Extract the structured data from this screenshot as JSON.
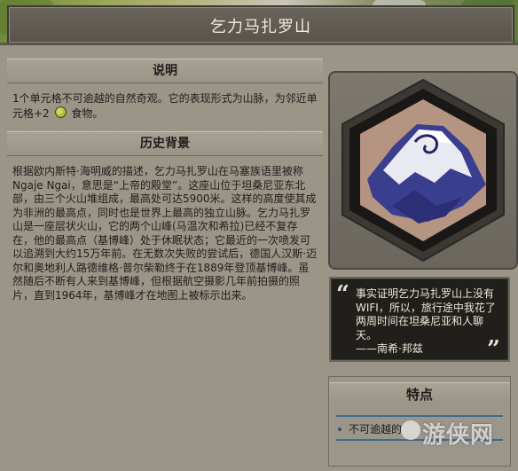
{
  "header": {
    "title": "乞力马扎罗山"
  },
  "description": {
    "heading": "说明",
    "text_before_icon": "1个单元格不可逾越的自然奇观。它的表现形式为山脉，为邻近单元格+2",
    "text_after_icon": "食物。",
    "food_icon": "food-icon"
  },
  "history": {
    "heading": "历史背景",
    "text": "根据欧内斯特·海明威的描述，乞力马扎罗山在马塞族语里被称Ngaje Ngai，意思是“上帝的殿堂”。这座山位于坦桑尼亚东北部，由三个火山堆组成，最高处可达5900米。这样的高度使其成为非洲的最高点，同时也是世界上最高的独立山脉。乞力马扎罗山是一座层状火山，它的两个山峰(马温次和希拉)已经不复存在，他的最高点（基博峰）处于休眠状态；它最近的一次喷发可以追溯到大约15万年前。在无数次失败的尝试后，德国人汉斯·迈尔和奥地利人路德维格·普尔柴勒终于在1889年登顶基博峰。虽然随后不断有人来到基博峰，但根据航空摄影几年前拍摄的照片，直到1964年，基博峰才在地图上被标示出来。"
  },
  "quote": {
    "text": "事实证明乞力马扎罗山上没有WIFI，所以，旅行途中我花了两周时间在坦桑尼亚和人聊天。",
    "author": "——南希·邦兹",
    "open_mark": "“",
    "close_mark": "”"
  },
  "traits": {
    "heading": "特点",
    "items": [
      "不可逾越的"
    ]
  },
  "watermark": {
    "text": "游侠网"
  },
  "colors": {
    "accent_line": "#3f6b8f",
    "quote_bg": "#211f1c",
    "panel_bg": "#9b9588"
  }
}
